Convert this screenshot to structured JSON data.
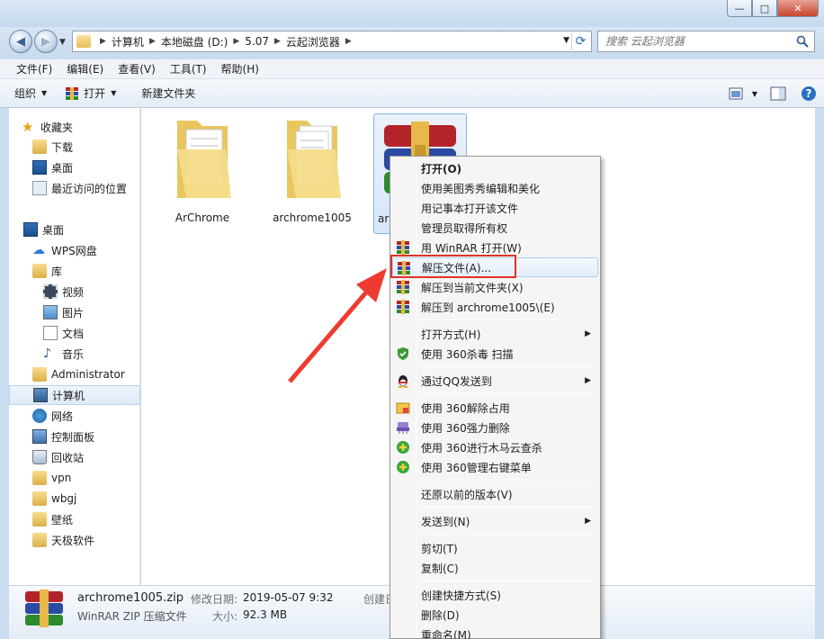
{
  "window": {
    "min": "—",
    "max": "□",
    "close": "✕"
  },
  "address": {
    "crumbs": [
      "计算机",
      "本地磁盘 (D:)",
      "5.07",
      "云起浏览器"
    ],
    "search_placeholder": "搜索 云起浏览器"
  },
  "menubar": [
    "文件(F)",
    "编辑(E)",
    "查看(V)",
    "工具(T)",
    "帮助(H)"
  ],
  "toolbar": {
    "organize": "组织",
    "open": "打开",
    "new_folder": "新建文件夹"
  },
  "sidebar": {
    "favorites": "收藏夹",
    "fav_items": [
      "下载",
      "桌面",
      "最近访问的位置"
    ],
    "desktop": "桌面",
    "wps": "WPS网盘",
    "library": "库",
    "lib_items": [
      "视频",
      "图片",
      "文档",
      "音乐"
    ],
    "admin": "Administrator",
    "computer": "计算机",
    "network": "网络",
    "control": "控制面板",
    "recycle": "回收站",
    "folders": [
      "vpn",
      "wbgj",
      "壁纸",
      "天极软件"
    ]
  },
  "files": [
    {
      "name": "ArChrome"
    },
    {
      "name": "archrome1005"
    },
    {
      "name": "ar"
    }
  ],
  "status": {
    "filename": "archrome1005.zip",
    "modified_label": "修改日期:",
    "modified": "2019-05-07 9:32",
    "created_label": "创建日",
    "type": "WinRAR ZIP 压缩文件",
    "size_label": "大小:",
    "size": "92.3 MB"
  },
  "context_menu": {
    "open": "打开(O)",
    "meitu": "使用美图秀秀编辑和美化",
    "notepad": "用记事本打开该文件",
    "admin_own": "管理员取得所有权",
    "winrar_open": "用 WinRAR 打开(W)",
    "extract": "解压文件(A)...",
    "extract_here": "解压到当前文件夹(X)",
    "extract_to": "解压到 archrome1005\\(E)",
    "open_with": "打开方式(H)",
    "scan360": "使用 360杀毒 扫描",
    "qq_send": "通过QQ发送到",
    "unlock360": "使用 360解除占用",
    "force_del360": "使用 360强力删除",
    "trojan360": "使用 360进行木马云查杀",
    "menu360": "使用 360管理右键菜单",
    "restore": "还原以前的版本(V)",
    "send_to": "发送到(N)",
    "cut": "剪切(T)",
    "copy": "复制(C)",
    "shortcut": "创建快捷方式(S)",
    "delete": "删除(D)",
    "rename": "重命名(M)"
  },
  "colors": {
    "highlight_red": "#e0322a",
    "arrow_red": "#ee3b2f"
  }
}
